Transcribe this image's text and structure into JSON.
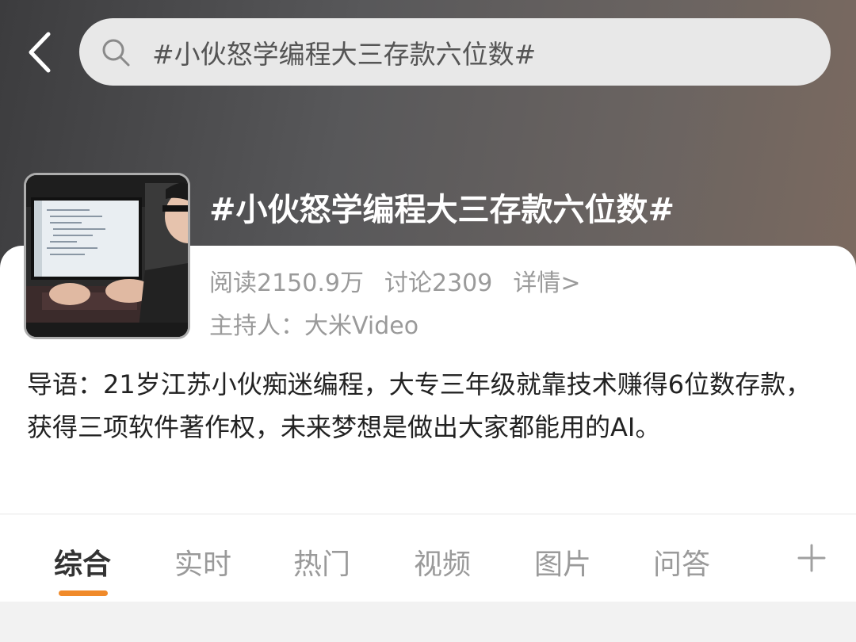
{
  "header": {
    "search_value": "#小伙怒学编程大三存款六位数#"
  },
  "topic": {
    "title": "#小伙怒学编程大三存款六位数#",
    "reads": "阅读2150.9万",
    "discussions": "讨论2309",
    "details_link": "详情>",
    "host": "主持人：大米Video",
    "intro": "导语：21岁江苏小伙痴迷编程，大专三年级就靠技术赚得6位数存款，获得三项软件著作权，未来梦想是做出大家都能用的AI。"
  },
  "tabs": [
    "综合",
    "实时",
    "热门",
    "视频",
    "图片",
    "问答"
  ],
  "active_tab": "综合",
  "colors": {
    "accent": "#f08a2a",
    "hero_start": "#3c3c3e",
    "hero_end": "#7c6a5f"
  },
  "icons": {
    "back": "chevron-left-icon",
    "search": "search-icon",
    "more_tabs": "plus-icon"
  }
}
